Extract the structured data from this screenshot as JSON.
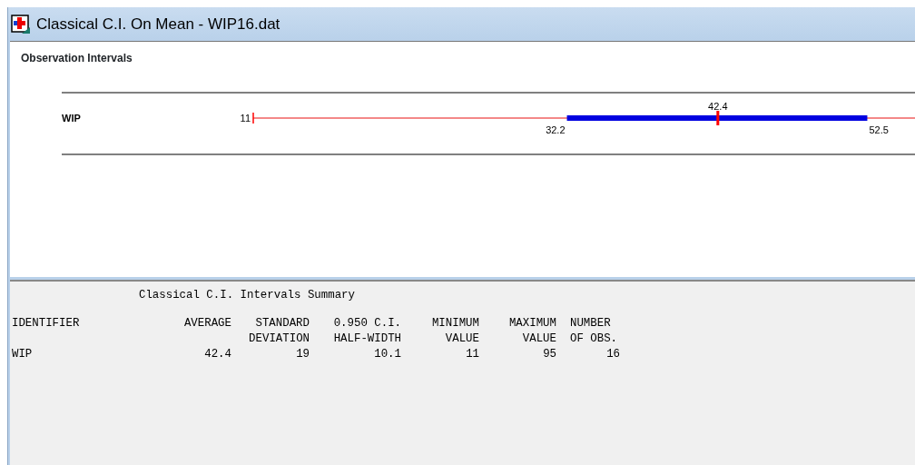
{
  "window": {
    "title": "Classical C.I. On Mean - WIP16.dat"
  },
  "plot": {
    "title": "Observation Intervals",
    "intervals": [
      {
        "label": "WIP",
        "minimum": "11",
        "lower": "32.2",
        "mean": "42.4",
        "upper": "52.5"
      }
    ]
  },
  "summary": {
    "title": "Classical C.I. Intervals Summary",
    "columns": [
      {
        "line1": "IDENTIFIER"
      },
      {
        "line1": "AVERAGE"
      },
      {
        "line1": "STANDARD",
        "line2": "DEVIATION"
      },
      {
        "line1": "0.950 C.I.",
        "line2": "HALF-WIDTH"
      },
      {
        "line1": "MINIMUM",
        "line2": "VALUE"
      },
      {
        "line1": "MAXIMUM",
        "line2": "VALUE"
      },
      {
        "line1": "NUMBER",
        "line2": "OF OBS."
      }
    ],
    "rows": [
      [
        "WIP",
        "42.4",
        "19",
        "10.1",
        "11",
        "95",
        "16"
      ]
    ]
  }
}
